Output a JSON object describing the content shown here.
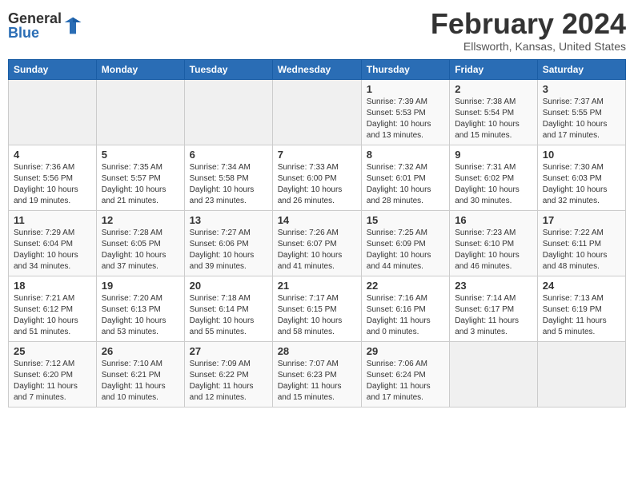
{
  "logo": {
    "general": "General",
    "blue": "Blue"
  },
  "header": {
    "month_year": "February 2024",
    "location": "Ellsworth, Kansas, United States"
  },
  "weekdays": [
    "Sunday",
    "Monday",
    "Tuesday",
    "Wednesday",
    "Thursday",
    "Friday",
    "Saturday"
  ],
  "weeks": [
    [
      {
        "day": "",
        "info": ""
      },
      {
        "day": "",
        "info": ""
      },
      {
        "day": "",
        "info": ""
      },
      {
        "day": "",
        "info": ""
      },
      {
        "day": "1",
        "info": "Sunrise: 7:39 AM\nSunset: 5:53 PM\nDaylight: 10 hours\nand 13 minutes."
      },
      {
        "day": "2",
        "info": "Sunrise: 7:38 AM\nSunset: 5:54 PM\nDaylight: 10 hours\nand 15 minutes."
      },
      {
        "day": "3",
        "info": "Sunrise: 7:37 AM\nSunset: 5:55 PM\nDaylight: 10 hours\nand 17 minutes."
      }
    ],
    [
      {
        "day": "4",
        "info": "Sunrise: 7:36 AM\nSunset: 5:56 PM\nDaylight: 10 hours\nand 19 minutes."
      },
      {
        "day": "5",
        "info": "Sunrise: 7:35 AM\nSunset: 5:57 PM\nDaylight: 10 hours\nand 21 minutes."
      },
      {
        "day": "6",
        "info": "Sunrise: 7:34 AM\nSunset: 5:58 PM\nDaylight: 10 hours\nand 23 minutes."
      },
      {
        "day": "7",
        "info": "Sunrise: 7:33 AM\nSunset: 6:00 PM\nDaylight: 10 hours\nand 26 minutes."
      },
      {
        "day": "8",
        "info": "Sunrise: 7:32 AM\nSunset: 6:01 PM\nDaylight: 10 hours\nand 28 minutes."
      },
      {
        "day": "9",
        "info": "Sunrise: 7:31 AM\nSunset: 6:02 PM\nDaylight: 10 hours\nand 30 minutes."
      },
      {
        "day": "10",
        "info": "Sunrise: 7:30 AM\nSunset: 6:03 PM\nDaylight: 10 hours\nand 32 minutes."
      }
    ],
    [
      {
        "day": "11",
        "info": "Sunrise: 7:29 AM\nSunset: 6:04 PM\nDaylight: 10 hours\nand 34 minutes."
      },
      {
        "day": "12",
        "info": "Sunrise: 7:28 AM\nSunset: 6:05 PM\nDaylight: 10 hours\nand 37 minutes."
      },
      {
        "day": "13",
        "info": "Sunrise: 7:27 AM\nSunset: 6:06 PM\nDaylight: 10 hours\nand 39 minutes."
      },
      {
        "day": "14",
        "info": "Sunrise: 7:26 AM\nSunset: 6:07 PM\nDaylight: 10 hours\nand 41 minutes."
      },
      {
        "day": "15",
        "info": "Sunrise: 7:25 AM\nSunset: 6:09 PM\nDaylight: 10 hours\nand 44 minutes."
      },
      {
        "day": "16",
        "info": "Sunrise: 7:23 AM\nSunset: 6:10 PM\nDaylight: 10 hours\nand 46 minutes."
      },
      {
        "day": "17",
        "info": "Sunrise: 7:22 AM\nSunset: 6:11 PM\nDaylight: 10 hours\nand 48 minutes."
      }
    ],
    [
      {
        "day": "18",
        "info": "Sunrise: 7:21 AM\nSunset: 6:12 PM\nDaylight: 10 hours\nand 51 minutes."
      },
      {
        "day": "19",
        "info": "Sunrise: 7:20 AM\nSunset: 6:13 PM\nDaylight: 10 hours\nand 53 minutes."
      },
      {
        "day": "20",
        "info": "Sunrise: 7:18 AM\nSunset: 6:14 PM\nDaylight: 10 hours\nand 55 minutes."
      },
      {
        "day": "21",
        "info": "Sunrise: 7:17 AM\nSunset: 6:15 PM\nDaylight: 10 hours\nand 58 minutes."
      },
      {
        "day": "22",
        "info": "Sunrise: 7:16 AM\nSunset: 6:16 PM\nDaylight: 11 hours\nand 0 minutes."
      },
      {
        "day": "23",
        "info": "Sunrise: 7:14 AM\nSunset: 6:17 PM\nDaylight: 11 hours\nand 3 minutes."
      },
      {
        "day": "24",
        "info": "Sunrise: 7:13 AM\nSunset: 6:19 PM\nDaylight: 11 hours\nand 5 minutes."
      }
    ],
    [
      {
        "day": "25",
        "info": "Sunrise: 7:12 AM\nSunset: 6:20 PM\nDaylight: 11 hours\nand 7 minutes."
      },
      {
        "day": "26",
        "info": "Sunrise: 7:10 AM\nSunset: 6:21 PM\nDaylight: 11 hours\nand 10 minutes."
      },
      {
        "day": "27",
        "info": "Sunrise: 7:09 AM\nSunset: 6:22 PM\nDaylight: 11 hours\nand 12 minutes."
      },
      {
        "day": "28",
        "info": "Sunrise: 7:07 AM\nSunset: 6:23 PM\nDaylight: 11 hours\nand 15 minutes."
      },
      {
        "day": "29",
        "info": "Sunrise: 7:06 AM\nSunset: 6:24 PM\nDaylight: 11 hours\nand 17 minutes."
      },
      {
        "day": "",
        "info": ""
      },
      {
        "day": "",
        "info": ""
      }
    ]
  ]
}
